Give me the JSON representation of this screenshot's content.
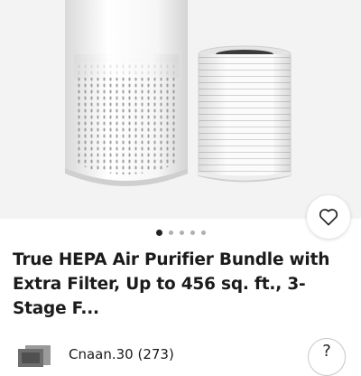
{
  "listing": {
    "title": "True HEPA Air Purifier Bundle with Extra Filter, Up to 456 sq. ft., 3-Stage F...",
    "image_count": 5,
    "active_image_index": 0
  },
  "seller": {
    "name_rating": "Cnaan.30 (273)"
  },
  "icons": {
    "favorite": "heart-outline-icon",
    "help": "question-mark-icon"
  },
  "help": {
    "glyph": "?"
  },
  "colors": {
    "hero_background": "#f3f3f3",
    "text": "#1b1b1b",
    "dot_active": "#222222",
    "dot_inactive": "#b0b0b0"
  }
}
